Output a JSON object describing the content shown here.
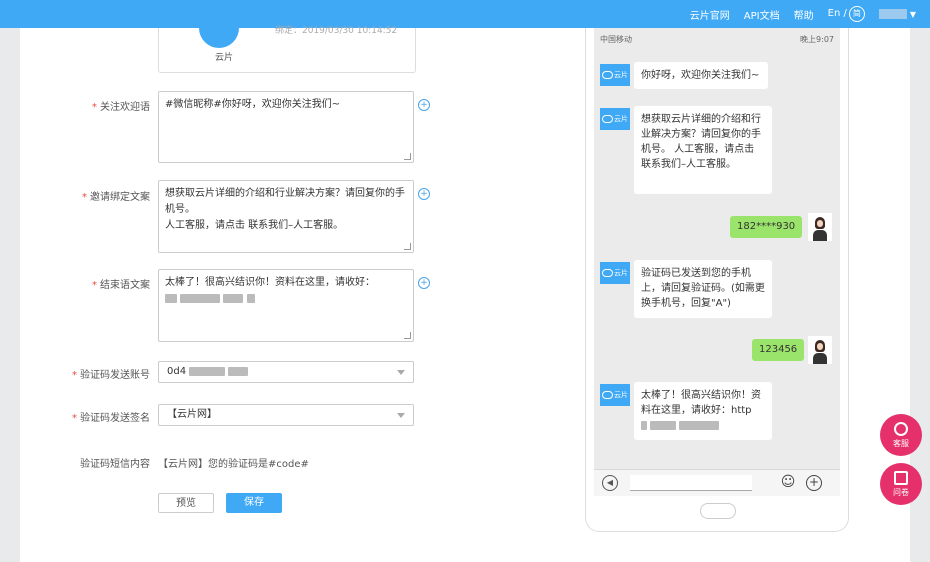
{
  "topnav": {
    "items": [
      "云片官网",
      "API文档",
      "帮助"
    ],
    "lang": "En /",
    "lang_badge": "简"
  },
  "account_card": {
    "name": "云片",
    "bind_time": "绑定：2019/03/30 10:14:52"
  },
  "form": {
    "welcome": {
      "label": "关注欢迎语",
      "value": "#微信昵称#你好呀，欢迎你关注我们~"
    },
    "invite": {
      "label": "邀请绑定文案",
      "value": "想获取云片详细的介绍和行业解决方案？请回复你的手机号。\n人工客服，请点击 联系我们–人工客服。"
    },
    "closing": {
      "label": "结束语文案",
      "value": "太棒了！很高兴结识你！资料在这里，请收好："
    },
    "account": {
      "label": "验证码发送账号",
      "value": "0d4"
    },
    "signature": {
      "label": "验证码发送签名",
      "value": "【云片网】"
    },
    "sms": {
      "label": "验证码短信内容",
      "value": "【云片网】您的验证码是#code#"
    },
    "required_mark": "*",
    "preview_label": "预览",
    "save_label": "保存"
  },
  "phone": {
    "carrier": "中国移动",
    "time": "晚上9:07",
    "bot_name": "云片",
    "messages": [
      {
        "from": "bot",
        "text": "你好呀，欢迎你关注我们~"
      },
      {
        "from": "bot",
        "text": "想获取云片详细的介绍和行业解决方案？请回复你的手机号。 人工客服，请点击 联系我们–人工客服。"
      },
      {
        "from": "user",
        "text": "182****930"
      },
      {
        "from": "bot",
        "text": "验证码已发送到您的手机上，请回复验证码。(如需更换手机号，回复\"A\")"
      },
      {
        "from": "user",
        "text": "123456"
      },
      {
        "from": "bot",
        "text": "太棒了！很高兴结识你！资料在这里，请收好：http"
      }
    ]
  },
  "float_buttons": {
    "service": "客服",
    "question": "问卷"
  },
  "colors": {
    "primary": "#3fa9f5",
    "float": "#e5306b",
    "user_bubble": "#9be46b"
  }
}
